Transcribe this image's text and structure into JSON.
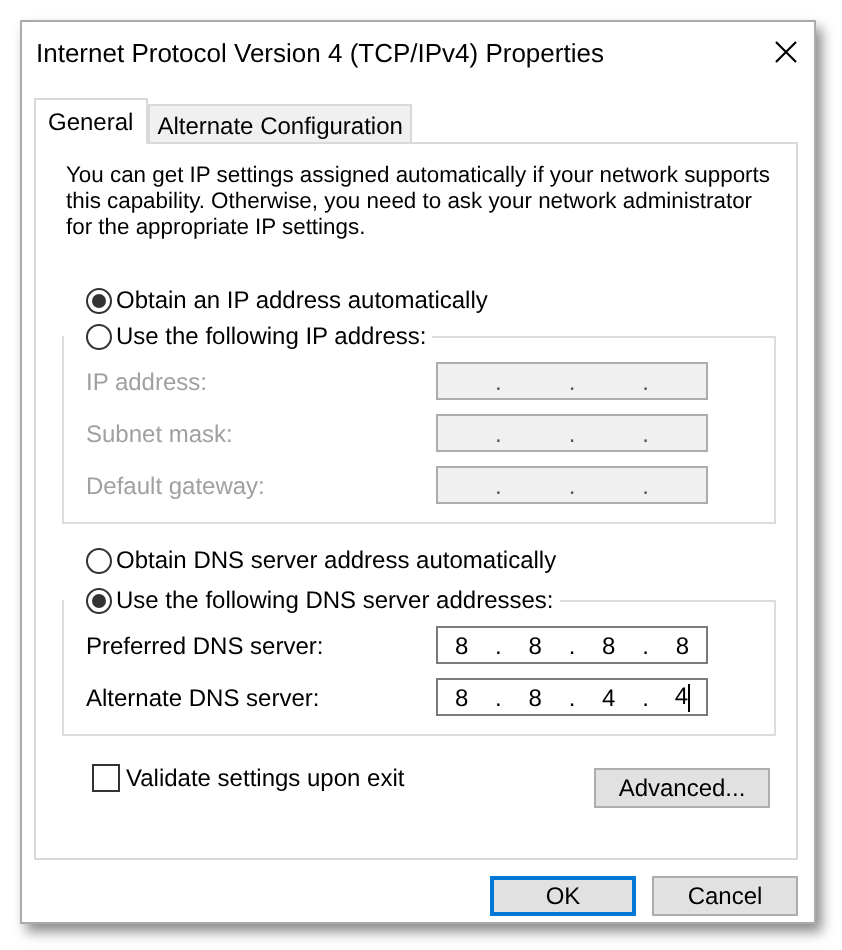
{
  "window": {
    "title": "Internet Protocol Version 4 (TCP/IPv4) Properties"
  },
  "tabs": [
    {
      "label": "General",
      "selected": true
    },
    {
      "label": "Alternate Configuration",
      "selected": false
    }
  ],
  "description": "You can get IP settings assigned automatically if your network supports this capability. Otherwise, you need to ask your network administrator for the appropriate IP settings.",
  "ip_settings": {
    "options": [
      {
        "label": "Obtain an IP address automatically",
        "selected": true
      },
      {
        "label": "Use the following IP address:",
        "selected": false
      }
    ],
    "fields": [
      {
        "label": "IP address:",
        "disabled": true,
        "separator": "."
      },
      {
        "label": "Subnet mask:",
        "disabled": true,
        "separator": "."
      },
      {
        "label": "Default gateway:",
        "disabled": true,
        "separator": "."
      }
    ]
  },
  "dns_settings": {
    "options": [
      {
        "label": "Obtain DNS server address automatically",
        "selected": false
      },
      {
        "label": "Use the following DNS server addresses:",
        "selected": true
      }
    ],
    "fields": [
      {
        "label": "Preferred DNS server:",
        "disabled": false,
        "separator": ".",
        "octets": [
          "8",
          "8",
          "8",
          "8"
        ],
        "focused": false
      },
      {
        "label": "Alternate DNS server:",
        "disabled": false,
        "separator": ".",
        "octets": [
          "8",
          "8",
          "4",
          "4"
        ],
        "focused": true
      }
    ]
  },
  "validate_checkbox": {
    "label": "Validate settings upon exit",
    "checked": false
  },
  "advanced_button": "Advanced...",
  "buttons": [
    {
      "label": "OK",
      "default": true
    },
    {
      "label": "Cancel",
      "default": false
    }
  ]
}
